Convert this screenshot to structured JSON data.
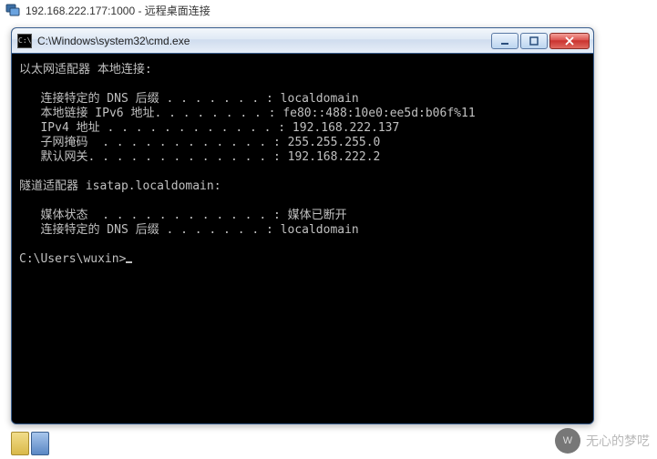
{
  "rdp": {
    "title": "192.168.222.177:1000 - 远程桌面连接"
  },
  "cmd": {
    "title": "C:\\Windows\\system32\\cmd.exe",
    "sections": {
      "ethernet_header": "以太网适配器 本地连接:",
      "eth": {
        "dns_suffix_label": "   连接特定的 DNS 后缀 . . . . . . . :",
        "dns_suffix_value": " localdomain",
        "ipv6_label": "   本地链接 IPv6 地址. . . . . . . . :",
        "ipv6_value": " fe80::488:10e0:ee5d:b06f%11",
        "ipv4_label": "   IPv4 地址 . . . . . . . . . . . . :",
        "ipv4_value": " 192.168.222.137",
        "mask_label": "   子网掩码  . . . . . . . . . . . . :",
        "mask_value": " 255.255.255.0",
        "gateway_label": "   默认网关. . . . . . . . . . . . . :",
        "gateway_value": " 192.168.222.2"
      },
      "tunnel_header": "隧道适配器 isatap.localdomain:",
      "tun": {
        "media_label": "   媒体状态  . . . . . . . . . . . . :",
        "media_value": " 媒体已断开",
        "dns_suffix_label": "   连接特定的 DNS 后缀 . . . . . . . :",
        "dns_suffix_value": " localdomain"
      },
      "prompt": "C:\\Users\\wuxin>"
    }
  },
  "watermark": {
    "text": "无心的梦呓",
    "badge": "W"
  }
}
